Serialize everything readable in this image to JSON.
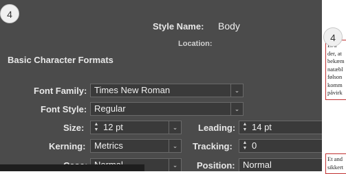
{
  "badges": {
    "first": "4",
    "second": "4"
  },
  "dialog": {
    "style_name_label": "Style Name:",
    "style_name_value": "Body",
    "location_label": "Location:",
    "section_title": "Basic Character Formats",
    "font_family_label": "Font Family:",
    "font_family_value": "Times New Roman",
    "font_style_label": "Font Style:",
    "font_style_value": "Regular",
    "size_label": "Size:",
    "size_value": "12 pt",
    "leading_label": "Leading:",
    "leading_value": "14 pt",
    "kerning_label": "Kerning:",
    "kerning_value": "Metrics",
    "tracking_label": "Tracking:",
    "tracking_value": "0",
    "case_label": "Case:",
    "case_value": "Normal",
    "position_label": "Position:",
    "position_value": "Normal"
  },
  "document_preview": {
    "lines": [
      "Et a",
      "der, at",
      "bekæm",
      "natæbl",
      "følson",
      "komm",
      "påvirk"
    ],
    "lines_2": [
      "Et and",
      "sikkert"
    ]
  },
  "icons": {
    "chevron": "⌄",
    "spinner_up": "▲",
    "spinner_down": "▼"
  },
  "colors": {
    "dialog_bg": "#4b4b4b",
    "field_bg": "#3a3a3a",
    "frame_border": "#c03030"
  }
}
